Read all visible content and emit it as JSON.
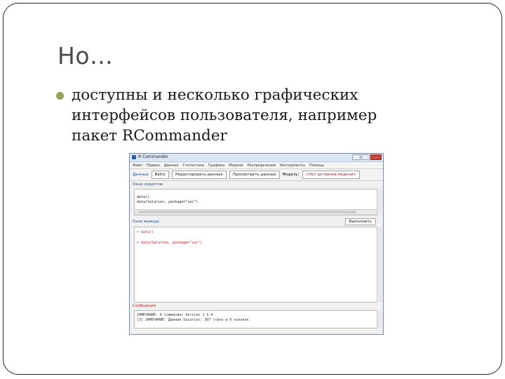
{
  "slide": {
    "title": "Но…",
    "bullet": "доступны и несколько графических интерфейсов пользователя, например пакет RCommander"
  },
  "rcmdr": {
    "window_title": "R Commander",
    "menu": [
      "Файл",
      "Правка",
      "Данные",
      "Статистика",
      "Графики",
      "Модели",
      "Распределения",
      "Инструменты",
      "Помощь"
    ],
    "toolbar": {
      "data_label": "Данные",
      "data_value": "Baltic",
      "edit_button": "Редактировать данные",
      "view_button": "Просмотреть данные",
      "model_label": "Модель:",
      "model_value": "<Нет активной модели>"
    },
    "script_label": "Окно скриптов",
    "script_lines": [
      "data()",
      "data(Salaries, package=\"car\")"
    ],
    "output_label": "Окно вывода",
    "run_button": "Выполнить",
    "output_lines": [
      "> data()",
      "> data(Salaries, package=\"car\")"
    ],
    "messages_label": "Сообщения",
    "message_lines": [
      "ЗАМЕЧАНИЕ: R Commander Version 1.5-4",
      "[3] ЗАМЕЧАНИЕ: Данные Salaries: 397 строк и 6 колонок."
    ]
  },
  "colors": {
    "bullet": "#9aa05a",
    "title": "#4a4a4a",
    "rcmdr_blue_label": "#1a4e9a",
    "rcmdr_red": "#c1272d"
  }
}
